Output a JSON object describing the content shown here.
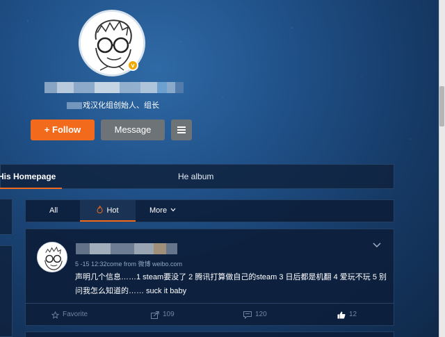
{
  "profile": {
    "verify_text": "戏汉化组创始人、组长",
    "verified_badge": "v"
  },
  "actions": {
    "follow_label": "Follow",
    "follow_icon": "+",
    "message_label": "Message",
    "menu_icon": "hamburger-menu-icon"
  },
  "tabs": {
    "home": "His Homepage",
    "album": "He album"
  },
  "filters": {
    "all": "All",
    "hot": "Hot",
    "more": "More"
  },
  "post": {
    "meta": "5 -15 12:32come from 微博 weibo.com",
    "body": "声明几个信息……1 steam要没了 2 腾讯打算做自己的steam 3 日后都是机翻 4 爱玩不玩 5 别问我怎么知道的…… suck it baby",
    "favorite_label": "Favorite",
    "forward_count": "109",
    "comment_count": "120",
    "like_count": "12"
  },
  "colors": {
    "accent": "#f26b1d",
    "panel": "#0c1e3a",
    "muted_text": "#6f87a5"
  }
}
